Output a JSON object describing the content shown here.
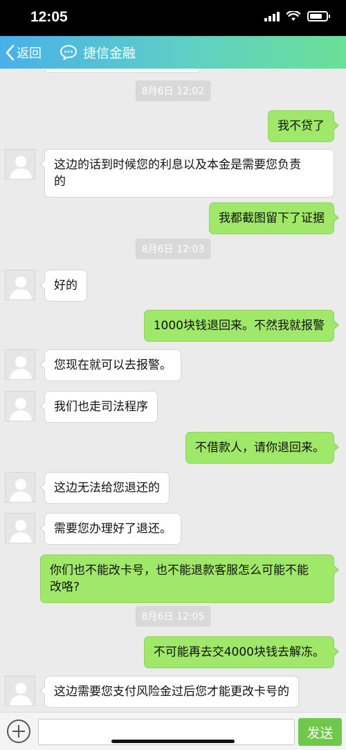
{
  "status_bar": {
    "time": "12:05"
  },
  "nav": {
    "back_label": "返回",
    "title": "捷信金融"
  },
  "icons": {
    "back": "chevron-left-icon",
    "chat": "chat-bubble-icon",
    "plus": "plus-circle-icon",
    "avatar": "person-icon"
  },
  "colors": {
    "nav_start": "#49b0ea",
    "nav_end": "#6cdf97",
    "outgoing_bubble": "#9fe86a",
    "send_button": "#6fc84a"
  },
  "messages": [
    {
      "kind": "time",
      "text": "8月6日 12:02"
    },
    {
      "kind": "out",
      "text": "我不贷了"
    },
    {
      "kind": "in",
      "text": "这边的话到时候您的利息以及本金是需要您负责\n的"
    },
    {
      "kind": "out",
      "text": "我都截图留下了证据"
    },
    {
      "kind": "time",
      "text": "8月6日 12:03"
    },
    {
      "kind": "in",
      "text": "好的"
    },
    {
      "kind": "out",
      "text": "1000块钱退回来。不然我就报警"
    },
    {
      "kind": "in",
      "text": "您现在就可以去报警。"
    },
    {
      "kind": "in",
      "text": "我们也走司法程序"
    },
    {
      "kind": "out",
      "text": "不借款人，请你退回来。"
    },
    {
      "kind": "in",
      "text": "这边无法给您退还的"
    },
    {
      "kind": "in",
      "text": "需要您办理好了退还。"
    },
    {
      "kind": "out",
      "text": "你们也不能改卡号，也不能退款客服怎么可能不能\n改咯?"
    },
    {
      "kind": "time",
      "text": "8月6日 12:05"
    },
    {
      "kind": "out",
      "text": "不可能再去交4000块钱去解冻。"
    },
    {
      "kind": "in",
      "text": "这边需要您支付风险金过后您才能更改卡号的"
    }
  ],
  "input_bar": {
    "placeholder": "",
    "value": "",
    "send_label": "发送"
  }
}
